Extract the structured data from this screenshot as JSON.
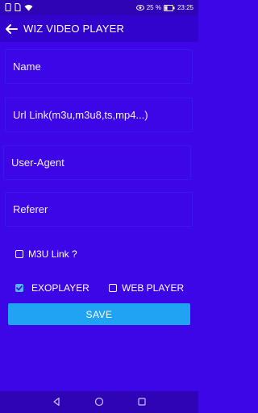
{
  "status_bar": {
    "battery_percent": "25 %",
    "time": "23:25",
    "left_icons": [
      "phone-icon",
      "sim-icon",
      "wifi-icon"
    ],
    "right_icons": [
      "eye-icon",
      "battery-icon"
    ]
  },
  "header": {
    "title": "WIZ VIDEO PLAYER"
  },
  "fields": {
    "name": "Name",
    "url": "Url Link(m3u,m3u8,ts,mp4...)",
    "user_agent": "User-Agent",
    "referer": "Referer"
  },
  "options": {
    "m3u_label": "M3U Link ?",
    "m3u_checked": false,
    "exoplayer_label": "EXOPLAYER",
    "exoplayer_checked": true,
    "webplayer_label": "WEB PLAYER",
    "webplayer_checked": false
  },
  "actions": {
    "save_label": "SAVE"
  },
  "colors": {
    "background": "#3c06e6",
    "app_bar": "#3103cc",
    "accent": "#1fa3f2"
  }
}
